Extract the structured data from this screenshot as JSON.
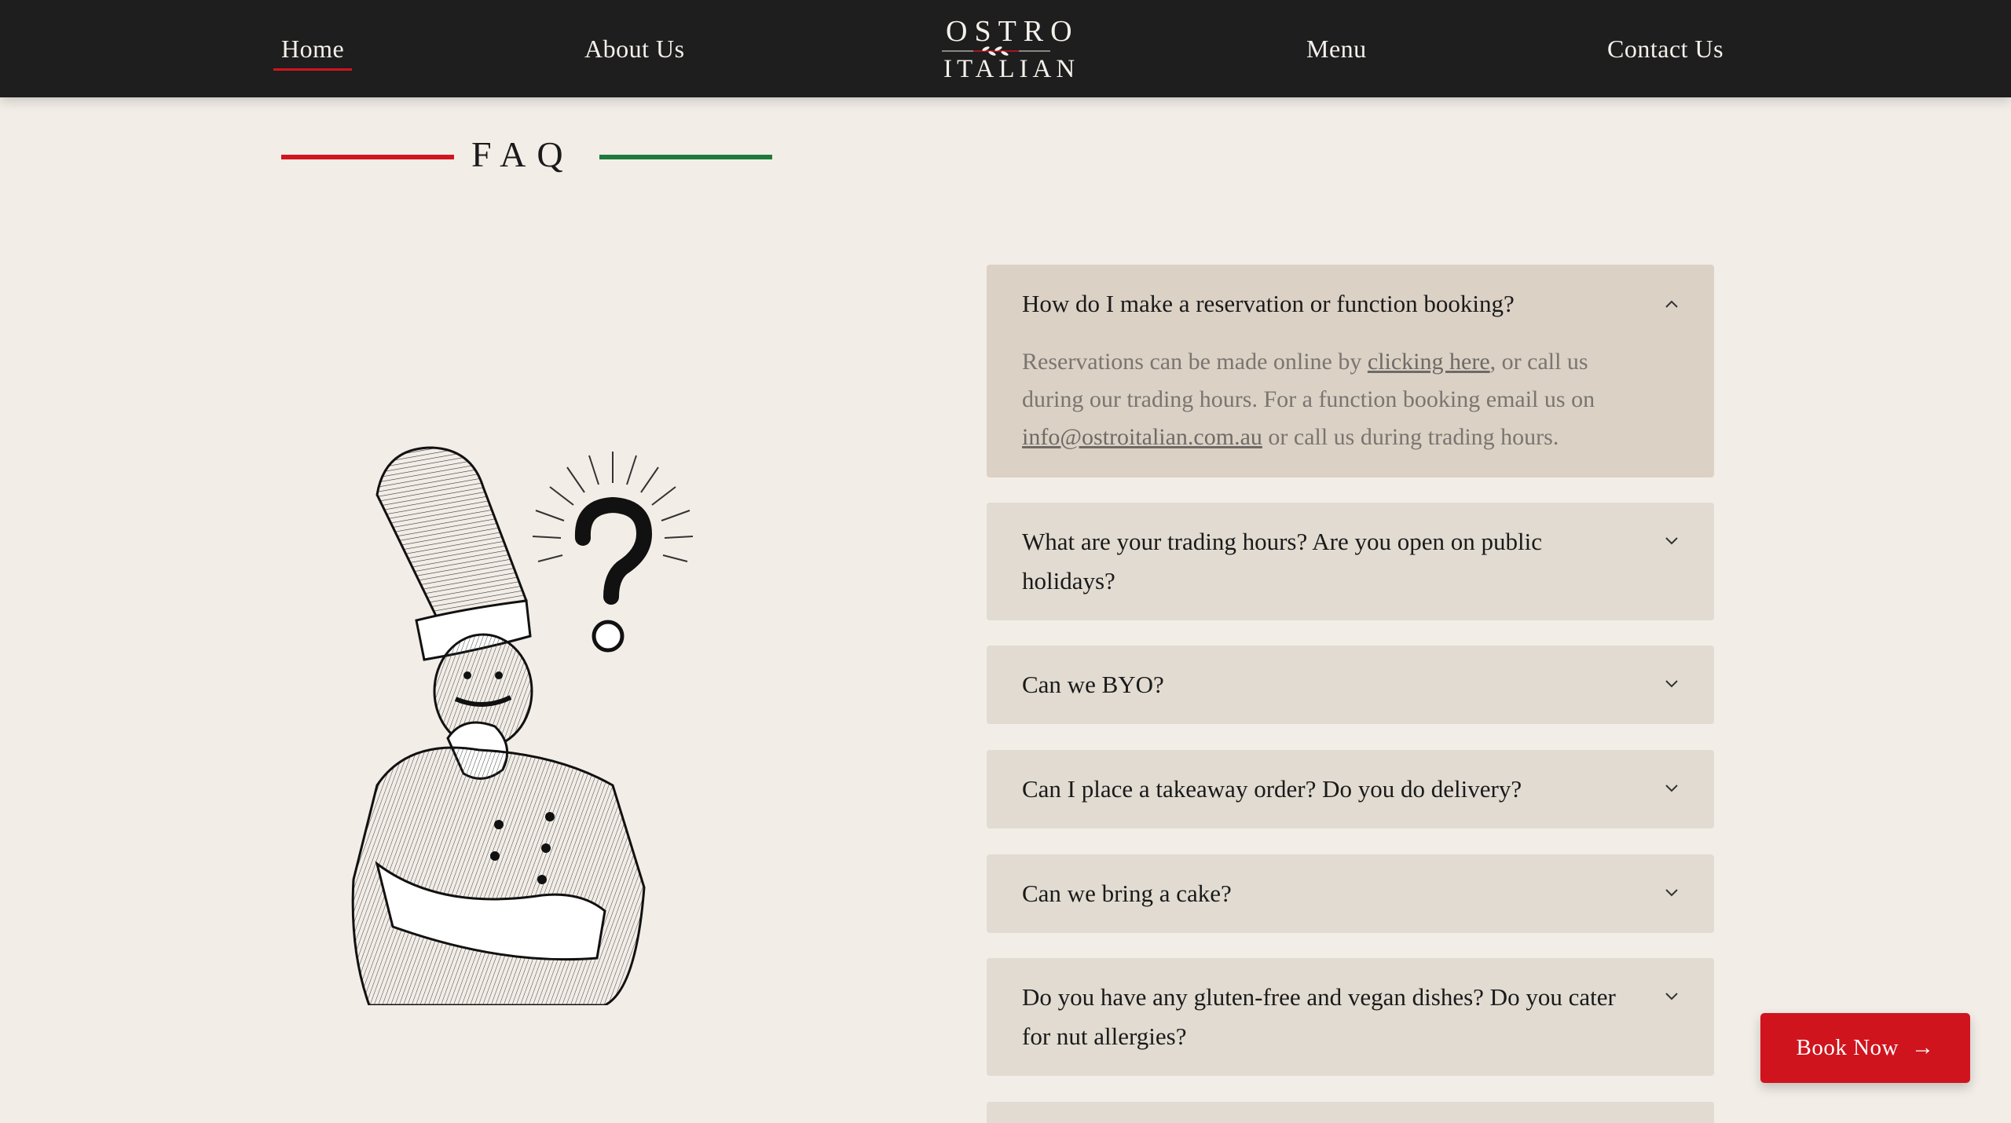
{
  "nav": {
    "links": [
      "Home",
      "About Us",
      "Menu",
      "Contact Us"
    ],
    "active": "Home",
    "logo_line1": "OSTRO",
    "logo_line2": "ITALIAN"
  },
  "faq": {
    "title": "FAQ",
    "colors": {
      "red": "#d0151e",
      "green": "#1e7a3c",
      "accent_button": "#cf141e"
    },
    "items": [
      {
        "question": "How do I make a reservation or function booking?",
        "expanded": true,
        "answer_part1": "Reservations can be made online by ",
        "answer_link1": "clicking here",
        "answer_part2": ", or call us during our trading hours. For a function booking email us on ",
        "answer_link2": "info@ostroitalian.com.au",
        "answer_part3": " or call us during trading hours."
      },
      {
        "question": "What are your trading hours? Are you open on public holidays?",
        "expanded": false
      },
      {
        "question": "Can we BYO?",
        "expanded": false
      },
      {
        "question": "Can I place a takeaway order? Do you do delivery?",
        "expanded": false
      },
      {
        "question": "Can we bring a cake?",
        "expanded": false
      },
      {
        "question": "Do you have any gluten-free and vegan dishes? Do you cater for nut allergies?",
        "expanded": false
      }
    ]
  },
  "cta": {
    "label": "Book Now",
    "arrow": "→"
  },
  "icons": [
    "chevron-up-icon",
    "chevron-down-icon",
    "arrow-right-icon",
    "chef-illustration",
    "question-mark-icon"
  ]
}
